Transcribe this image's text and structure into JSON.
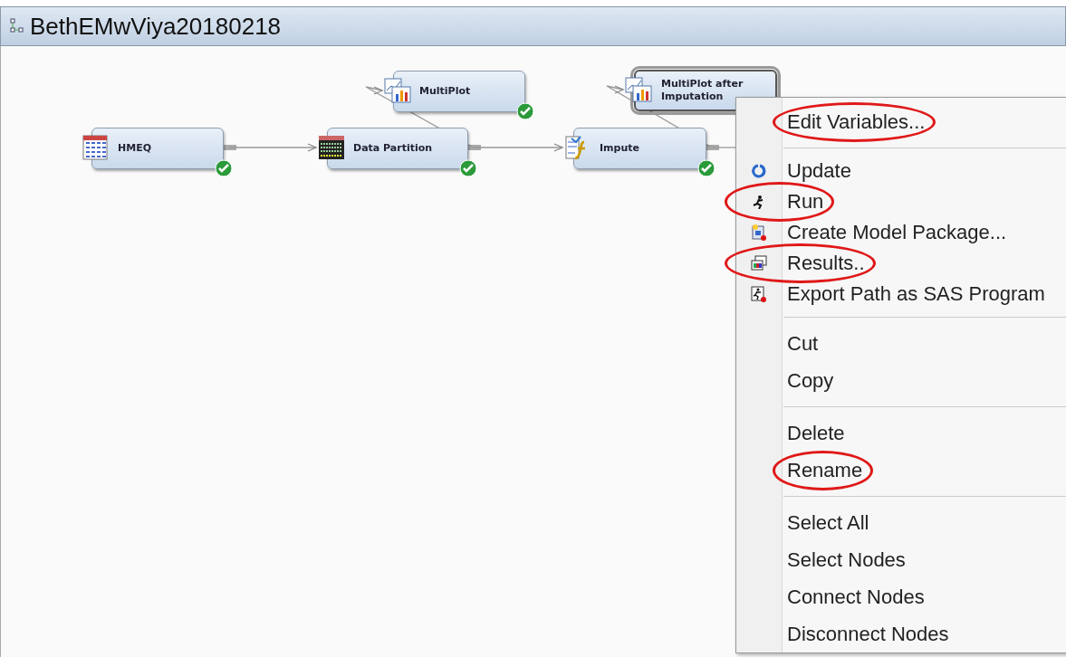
{
  "window": {
    "title": "BethEMwViya20180218"
  },
  "diagram": {
    "nodes": [
      {
        "label": "HMEQ",
        "kind": "table",
        "done": true,
        "selected": false
      },
      {
        "label": "Data Partition",
        "kind": "partition",
        "done": true,
        "selected": false
      },
      {
        "label": "MultiPlot",
        "kind": "plot",
        "done": true,
        "selected": false
      },
      {
        "label": "Impute",
        "kind": "impute",
        "done": true,
        "selected": false
      },
      {
        "label": "MultiPlot after Imputation",
        "kind": "plot",
        "done": false,
        "selected": true
      }
    ]
  },
  "menu": {
    "groups": [
      {
        "items": [
          {
            "label": "Edit Variables...",
            "kind": "plain",
            "circled": true
          }
        ]
      },
      {
        "items": [
          {
            "label": "Update",
            "kind": "update",
            "circled": false
          },
          {
            "label": "Run",
            "kind": "run",
            "circled": true
          },
          {
            "label": "Create Model Package...",
            "kind": "package",
            "circled": false
          },
          {
            "label": "Results..",
            "kind": "results",
            "circled": true
          },
          {
            "label": "Export Path as SAS Program",
            "kind": "export",
            "circled": false
          }
        ]
      },
      {
        "items": [
          {
            "label": "Cut",
            "kind": "plain",
            "circled": false
          },
          {
            "label": "Copy",
            "kind": "plain",
            "circled": false
          }
        ]
      },
      {
        "items": [
          {
            "label": "Delete",
            "kind": "plain",
            "circled": false
          },
          {
            "label": "Rename",
            "kind": "plain",
            "circled": true
          }
        ]
      },
      {
        "items": [
          {
            "label": "Select All",
            "kind": "plain",
            "circled": false
          },
          {
            "label": "Select Nodes",
            "kind": "plain",
            "circled": false
          },
          {
            "label": "Connect Nodes",
            "kind": "plain",
            "circled": false
          },
          {
            "label": "Disconnect Nodes",
            "kind": "plain",
            "circled": false
          }
        ]
      }
    ]
  }
}
